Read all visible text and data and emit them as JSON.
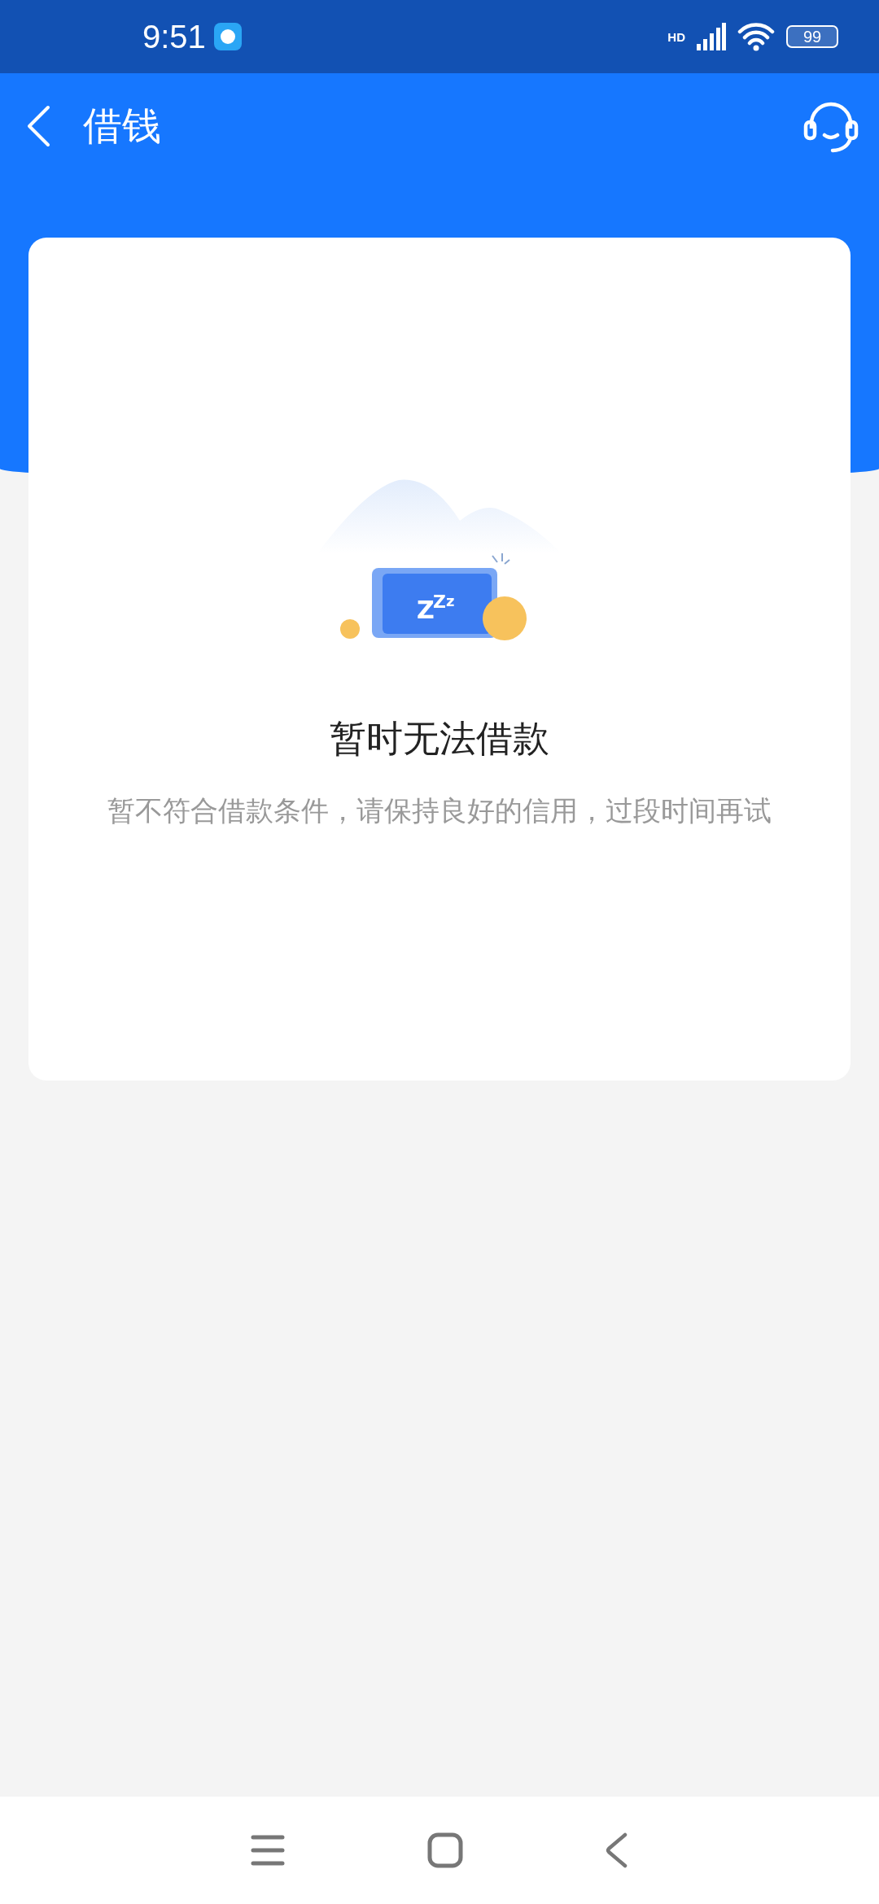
{
  "status_bar": {
    "time": "9:51",
    "network": "HD",
    "battery": "99"
  },
  "header": {
    "title": "借钱"
  },
  "illustration": {
    "snore": [
      "Z",
      "Z",
      "z"
    ]
  },
  "empty_state": {
    "title": "暂时无法借款",
    "message": "暂不符合借款条件，请保持良好的信用，过段时间再试"
  }
}
